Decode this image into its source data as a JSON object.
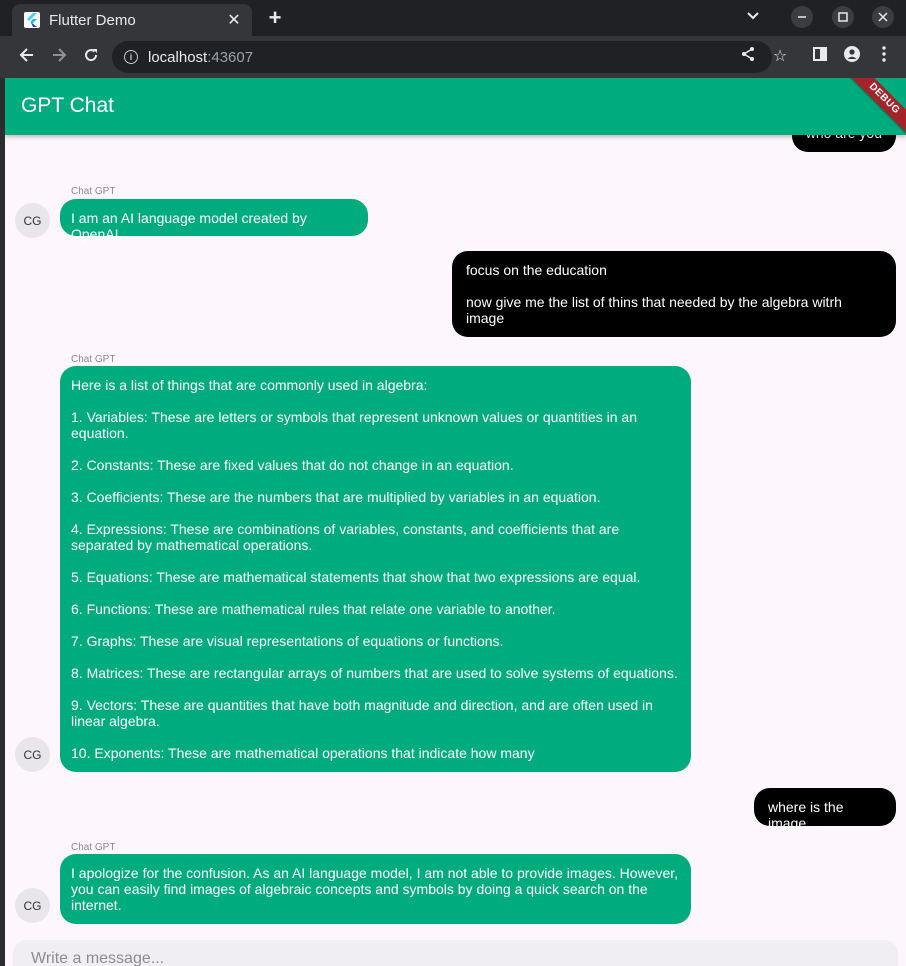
{
  "browser": {
    "tab_title": "Flutter Demo",
    "url_host": "localhost",
    "url_port": ":43607"
  },
  "app": {
    "title": "GPT Chat",
    "debug_label": "DEBUG"
  },
  "messages": [
    {
      "role": "user",
      "text": "who are you"
    },
    {
      "role": "bot",
      "sender": "Chat GPT",
      "avatar": "CG",
      "text": "I am an AI language model created by OpenAI."
    },
    {
      "role": "user",
      "text": "focus on the education\n\nnow give me the list of thins that needed by the algebra witrh image"
    },
    {
      "role": "bot",
      "sender": "Chat GPT",
      "avatar": "CG",
      "text": "Here is a list of things that are commonly used in algebra:\n\n1. Variables: These are letters or symbols that represent unknown values or quantities in an equation.\n\n2. Constants: These are fixed values that do not change in an equation.\n\n3. Coefficients: These are the numbers that are multiplied by variables in an equation.\n\n4. Expressions: These are combinations of variables, constants, and coefficients that are separated by mathematical operations.\n\n5. Equations: These are mathematical statements that show that two expressions are equal.\n\n6. Functions: These are mathematical rules that relate one variable to another.\n\n7. Graphs: These are visual representations of equations or functions.\n\n8. Matrices: These are rectangular arrays of numbers that are used to solve systems of equations.\n\n9. Vectors: These are quantities that have both magnitude and direction, and are often used in linear algebra.\n\n10. Exponents: These are mathematical operations that indicate how many"
    },
    {
      "role": "user",
      "text": "where is the image"
    },
    {
      "role": "bot",
      "sender": "Chat GPT",
      "avatar": "CG",
      "text": "I apologize for the confusion. As an AI language model, I am not able to provide images. However, you can easily find images of algebraic concepts and symbols by doing a quick search on the internet."
    }
  ],
  "composer": {
    "placeholder": "Write a message..."
  },
  "colors": {
    "accent": "#00ac7e",
    "user_bubble": "#000000",
    "background": "#fdf7fd"
  }
}
